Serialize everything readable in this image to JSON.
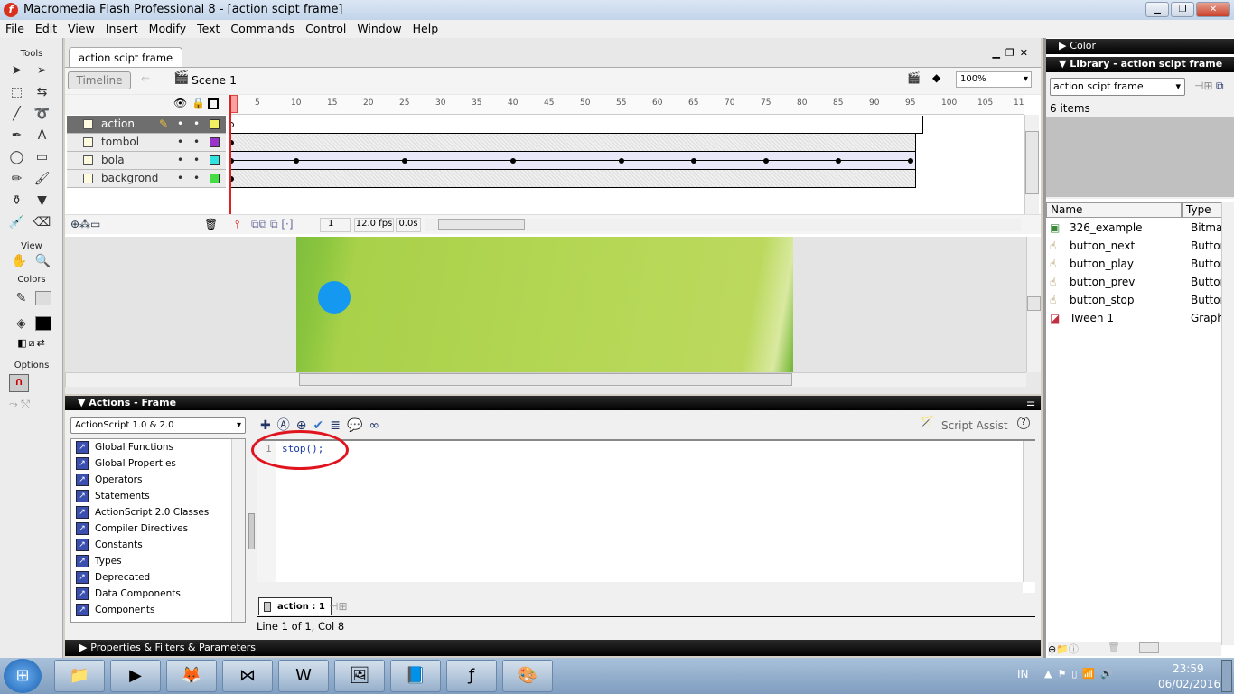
{
  "window": {
    "title": "Macromedia Flash Professional 8 - [action scipt frame]",
    "controls": [
      "minimize",
      "restore",
      "close"
    ]
  },
  "menu": [
    "File",
    "Edit",
    "View",
    "Insert",
    "Modify",
    "Text",
    "Commands",
    "Control",
    "Window",
    "Help"
  ],
  "tools": {
    "label": "Tools",
    "view_label": "View",
    "colors_label": "Colors",
    "options_label": "Options"
  },
  "document": {
    "tab": "action scipt frame",
    "timeline_button": "Timeline",
    "scene": "Scene 1",
    "zoom": "100%"
  },
  "timeline": {
    "ruler": [
      "1",
      "5",
      "10",
      "15",
      "20",
      "25",
      "30",
      "35",
      "40",
      "45",
      "50",
      "55",
      "60",
      "65",
      "70",
      "75",
      "80",
      "85",
      "90",
      "95",
      "100",
      "105",
      "11"
    ],
    "layers": [
      {
        "name": "action",
        "color": "#f0f060",
        "selected": true,
        "keyframes": [
          1
        ],
        "end": 96,
        "type": "blank"
      },
      {
        "name": "tombol",
        "color": "#9933cc",
        "keyframes": [
          1
        ],
        "end": 95,
        "type": "static"
      },
      {
        "name": "bola",
        "color": "#33e0e0",
        "keyframes": [
          1,
          10,
          25,
          40,
          55,
          65,
          75,
          85,
          95
        ],
        "end": 95,
        "type": "tween"
      },
      {
        "name": "backgrond",
        "color": "#44dd44",
        "keyframes": [
          1
        ],
        "end": 95,
        "type": "static"
      }
    ],
    "current_frame": "1",
    "fps": "12.0 fps",
    "time": "0.0s"
  },
  "actions": {
    "title": "Actions - Frame",
    "version": "ActionScript 1.0 & 2.0",
    "toolbox": [
      "Global Functions",
      "Global Properties",
      "Operators",
      "Statements",
      "ActionScript 2.0 Classes",
      "Compiler Directives",
      "Constants",
      "Types",
      "Deprecated",
      "Data Components",
      "Components"
    ],
    "code_line_number": "1",
    "code": "stop();",
    "script_assist": "Script Assist",
    "script_tab": "action : 1",
    "status": "Line 1 of 1, Col 8",
    "annotation_color": "#e0141e"
  },
  "properties": {
    "title": "Properties & Filters & Parameters"
  },
  "color_panel": {
    "title": "Color"
  },
  "library": {
    "title": "Library - action scipt frame",
    "document": "action scipt frame",
    "count": "6 items",
    "columns": [
      "Name",
      "Type"
    ],
    "items": [
      {
        "name": "326_example",
        "type": "Bitmap",
        "icon": "bitmap-icon"
      },
      {
        "name": "button_next",
        "type": "Button",
        "icon": "button-icon"
      },
      {
        "name": "button_play",
        "type": "Button",
        "icon": "button-icon"
      },
      {
        "name": "button_prev",
        "type": "Button",
        "icon": "button-icon"
      },
      {
        "name": "button_stop",
        "type": "Button",
        "icon": "button-icon"
      },
      {
        "name": "Tween 1",
        "type": "Graphic",
        "icon": "graphic-icon"
      }
    ]
  },
  "taskbar": {
    "apps": [
      "explorer",
      "media-player",
      "firefox",
      "visual-studio",
      "word",
      "photo-viewer",
      "notepad",
      "flash",
      "paint"
    ],
    "language": "IN",
    "time": "23:59",
    "date": "06/02/2016"
  }
}
